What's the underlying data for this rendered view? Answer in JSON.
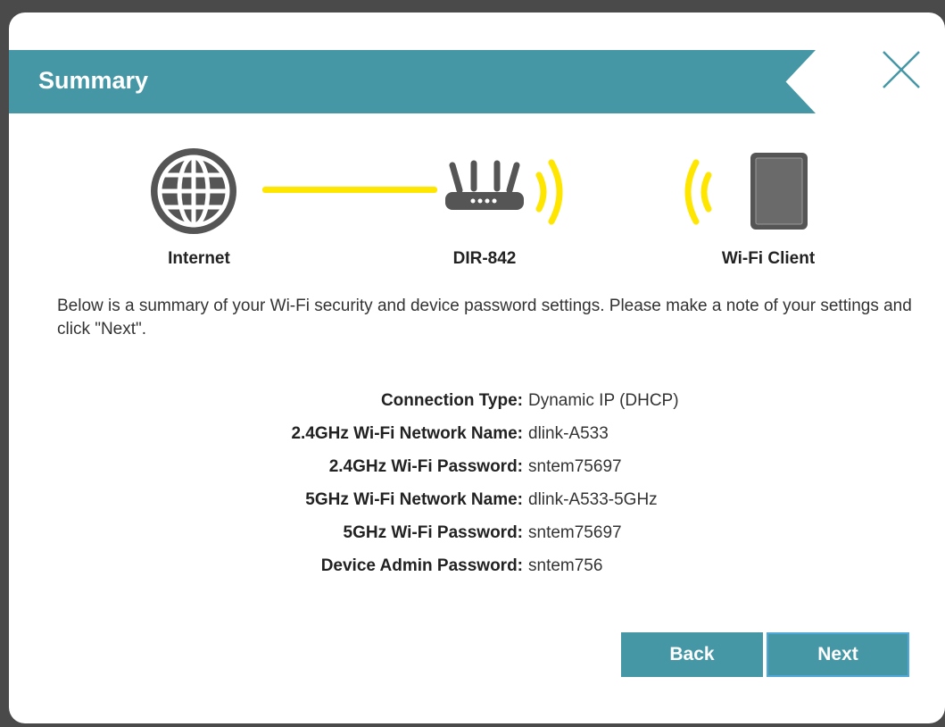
{
  "header": {
    "title": "Summary"
  },
  "diagram": {
    "internet_label": "Internet",
    "router_label": "DIR-842",
    "client_label": "Wi-Fi Client"
  },
  "description": "Below is a summary of your Wi-Fi security and device password settings. Please make a note of your settings and click \"Next\".",
  "summary": [
    {
      "label": "Connection Type:",
      "value": "Dynamic IP (DHCP)"
    },
    {
      "label": "2.4GHz Wi-Fi Network Name:",
      "value": "dlink-A533"
    },
    {
      "label": "2.4GHz Wi-Fi Password:",
      "value": "sntem75697"
    },
    {
      "label": "5GHz Wi-Fi Network Name:",
      "value": "dlink-A533-5GHz"
    },
    {
      "label": "5GHz Wi-Fi Password:",
      "value": "sntem75697"
    },
    {
      "label": "Device Admin Password:",
      "value": "sntem756"
    }
  ],
  "buttons": {
    "back": "Back",
    "next": "Next"
  },
  "colors": {
    "accent": "#4597a6",
    "signal": "#ffe600",
    "icon": "#555555"
  },
  "icons": {
    "close": "close-icon",
    "internet": "globe-icon",
    "router": "router-icon",
    "signal": "wifi-signal-icon",
    "client": "tablet-icon"
  }
}
